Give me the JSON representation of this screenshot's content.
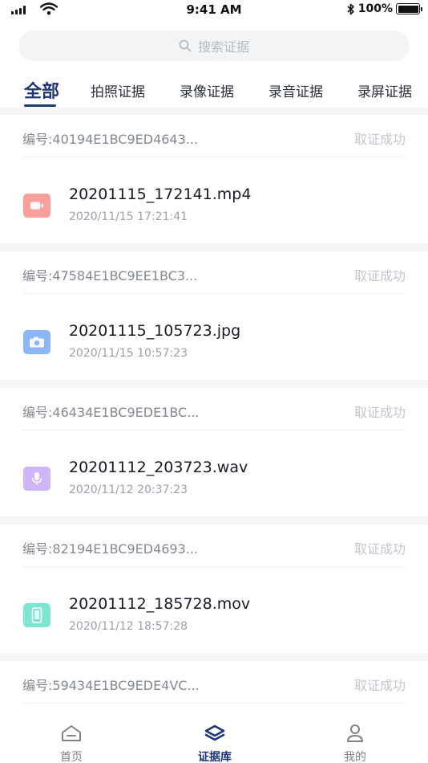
{
  "status_bar": {
    "time": "9:41 AM",
    "battery": "100%",
    "battery_level": 1.0
  },
  "search": {
    "placeholder": "搜索证据",
    "icon": "search-icon"
  },
  "tabs": [
    {
      "label": "全部",
      "active": true
    },
    {
      "label": "拍照证据",
      "active": false
    },
    {
      "label": "录像证据",
      "active": false
    },
    {
      "label": "录音证据",
      "active": false
    },
    {
      "label": "录屏证据",
      "active": false
    }
  ],
  "cards": [
    {
      "id_label": "编号:",
      "id_value": "40194E1BC9ED4643...",
      "status": "取证成功",
      "file_name": "20201115_172141.mp4",
      "time": "2020/11/15 17:21:41",
      "icon": "video-icon",
      "icon_color": "#fb9f9a"
    },
    {
      "id_label": "编号:",
      "id_value": "47584E1BC9EE1BC3...",
      "status": "取证成功",
      "file_name": "20201115_105723.jpg",
      "time": "2020/11/15 10:57:23",
      "icon": "camera-icon",
      "icon_color": "#8cb6f9"
    },
    {
      "id_label": "编号:",
      "id_value": "46434E1BC9EDE1BC...",
      "status": "取证成功",
      "file_name": "20201112_203723.wav",
      "time": "2020/11/12 20:37:23",
      "icon": "microphone-icon",
      "icon_color": "#cfb5f7"
    },
    {
      "id_label": "编号:",
      "id_value": "82194E1BC9ED4693...",
      "status": "取证成功",
      "file_name": "20201112_185728.mov",
      "time": "2020/11/12 18:57:28",
      "icon": "phone-screen-icon",
      "icon_color": "#7de6d2"
    },
    {
      "id_label": "编号:",
      "id_value": "59434E1BC9EDE4VC...",
      "status": "取证成功",
      "file_name": "",
      "time": "",
      "icon": "",
      "icon_color": ""
    }
  ],
  "bottom_nav": [
    {
      "label": "首页",
      "icon": "home-icon",
      "active": false
    },
    {
      "label": "证据库",
      "icon": "layers-icon",
      "active": true
    },
    {
      "label": "我的",
      "icon": "user-icon",
      "active": false
    }
  ],
  "colors": {
    "accent": "#21357a",
    "status_success": "#c2c6cd",
    "background": "#f4f5f7"
  }
}
